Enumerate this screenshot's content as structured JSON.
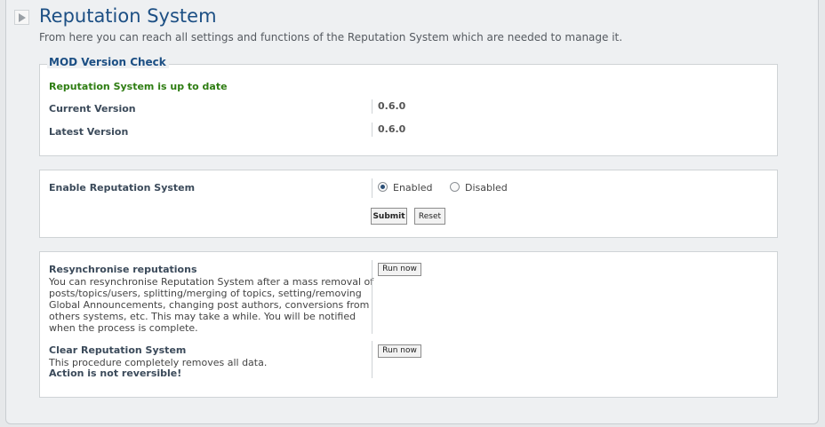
{
  "header": {
    "title": "Reputation System",
    "description": "From here you can reach all settings and functions of the Reputation System which are needed to manage it."
  },
  "version_check": {
    "legend": "MOD Version Check",
    "status": "Reputation System is up to date",
    "current_label": "Current Version",
    "current_value": "0.6.0",
    "latest_label": "Latest Version",
    "latest_value": "0.6.0"
  },
  "enable": {
    "label": "Enable Reputation System",
    "option_enabled": "Enabled",
    "option_disabled": "Disabled",
    "selected": "Enabled",
    "submit": "Submit",
    "reset": "Reset"
  },
  "tools": {
    "resync_title": "Resynchronise reputations",
    "resync_desc": "You can resynchronise Reputation System after a mass removal of posts/topics/users, splitting/merging of topics, setting/removing Global Announcements, changing post authors, conversions from others systems, etc. This may take a while. You will be notified when the process is complete.",
    "run_now": "Run now",
    "clear_title": "Clear Reputation System",
    "clear_desc": "This procedure completely removes all data.",
    "clear_warning": "Action is not reversible!"
  },
  "colors": {
    "title": "#1c4f84",
    "status_ok": "#2e7d12",
    "panel_bg": "#eef0f2"
  },
  "icons": {
    "header_toggle": "triangle-right-icon"
  }
}
